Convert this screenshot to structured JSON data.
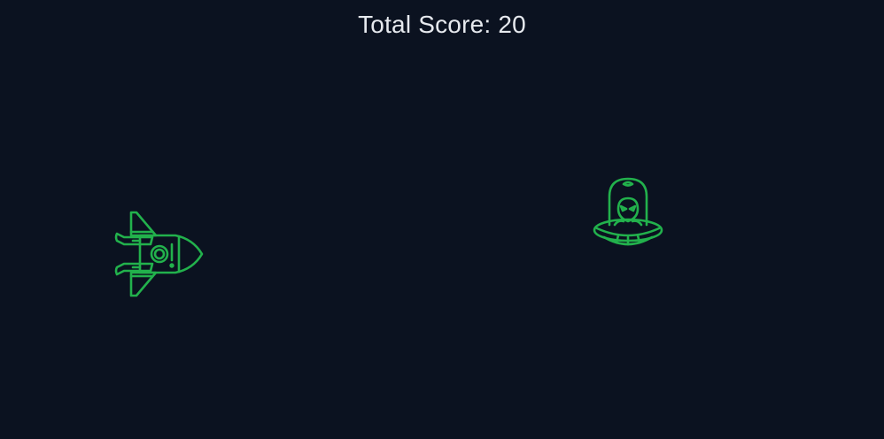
{
  "hud": {
    "score_label": "Total Score:",
    "score_value": "20"
  },
  "sprites": {
    "player": {
      "icon": "spaceship-icon"
    },
    "enemy": {
      "icon": "alien-ufo-icon"
    }
  },
  "colors": {
    "background": "#0b1220",
    "sprite_stroke": "#22b14c",
    "score_text": "#e6e9ee"
  }
}
